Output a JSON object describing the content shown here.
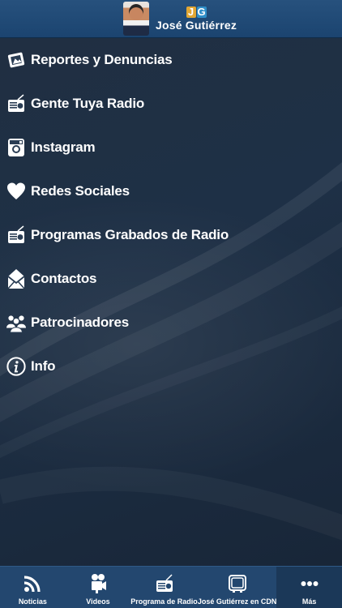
{
  "header": {
    "brand_mark": [
      "J",
      "G"
    ],
    "brand_name": "José Gutiérrez"
  },
  "menu": {
    "items": [
      {
        "label": "Reportes y Denuncias",
        "icon": "camera-report-icon"
      },
      {
        "label": "Gente Tuya Radio",
        "icon": "radio-icon"
      },
      {
        "label": "Instagram",
        "icon": "instagram-icon"
      },
      {
        "label": "Redes Sociales",
        "icon": "heart-icon"
      },
      {
        "label": "Programas Grabados de Radio",
        "icon": "radio-icon"
      },
      {
        "label": "Contactos",
        "icon": "mail-icon"
      },
      {
        "label": "Patrocinadores",
        "icon": "people-icon"
      },
      {
        "label": "Info",
        "icon": "info-icon"
      }
    ]
  },
  "tabbar": {
    "tabs": [
      {
        "label": "Noticias",
        "icon": "rss-icon"
      },
      {
        "label": "Videos",
        "icon": "video-camera-icon"
      },
      {
        "label": "Programa de Radio",
        "icon": "radio-icon"
      },
      {
        "label": "José Gutiérrez en CDN",
        "icon": "tv-icon"
      },
      {
        "label": "Más",
        "icon": "more-icon"
      }
    ],
    "active_tab": "Más"
  },
  "colors": {
    "header_bg": "#1b4470",
    "content_bg": "#1e3046",
    "tabbar_bg": "#23476f",
    "text": "#ffffff"
  }
}
